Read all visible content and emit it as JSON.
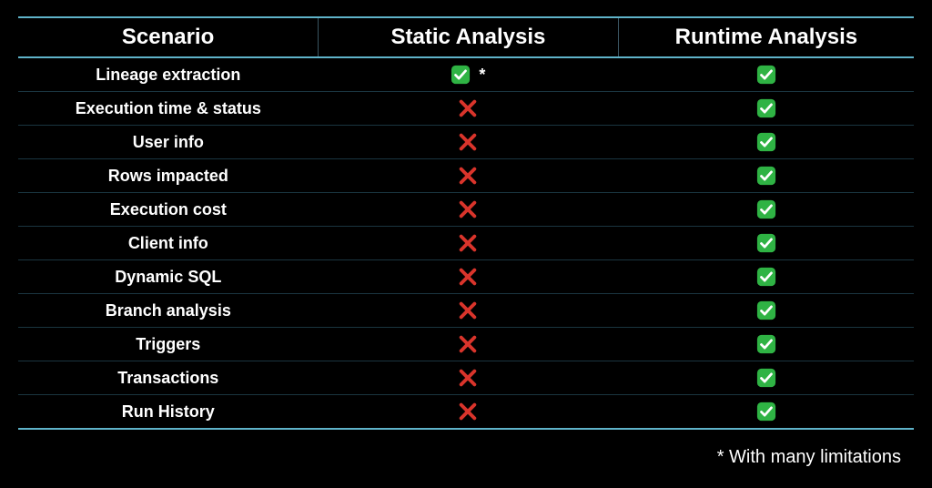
{
  "chart_data": {
    "type": "table",
    "title": "",
    "columns": [
      "Scenario",
      "Static Analysis",
      "Runtime Analysis"
    ],
    "rows": [
      {
        "scenario": "Lineage extraction",
        "static": "yes_note",
        "runtime": "yes"
      },
      {
        "scenario": "Execution time & status",
        "static": "no",
        "runtime": "yes"
      },
      {
        "scenario": "User info",
        "static": "no",
        "runtime": "yes"
      },
      {
        "scenario": "Rows impacted",
        "static": "no",
        "runtime": "yes"
      },
      {
        "scenario": "Execution cost",
        "static": "no",
        "runtime": "yes"
      },
      {
        "scenario": "Client info",
        "static": "no",
        "runtime": "yes"
      },
      {
        "scenario": "Dynamic SQL",
        "static": "no",
        "runtime": "yes"
      },
      {
        "scenario": "Branch analysis",
        "static": "no",
        "runtime": "yes"
      },
      {
        "scenario": "Triggers",
        "static": "no",
        "runtime": "yes"
      },
      {
        "scenario": "Transactions",
        "static": "no",
        "runtime": "yes"
      },
      {
        "scenario": "Run History",
        "static": "no",
        "runtime": "yes"
      }
    ],
    "note_marker": "*",
    "footnote": "* With many limitations"
  }
}
